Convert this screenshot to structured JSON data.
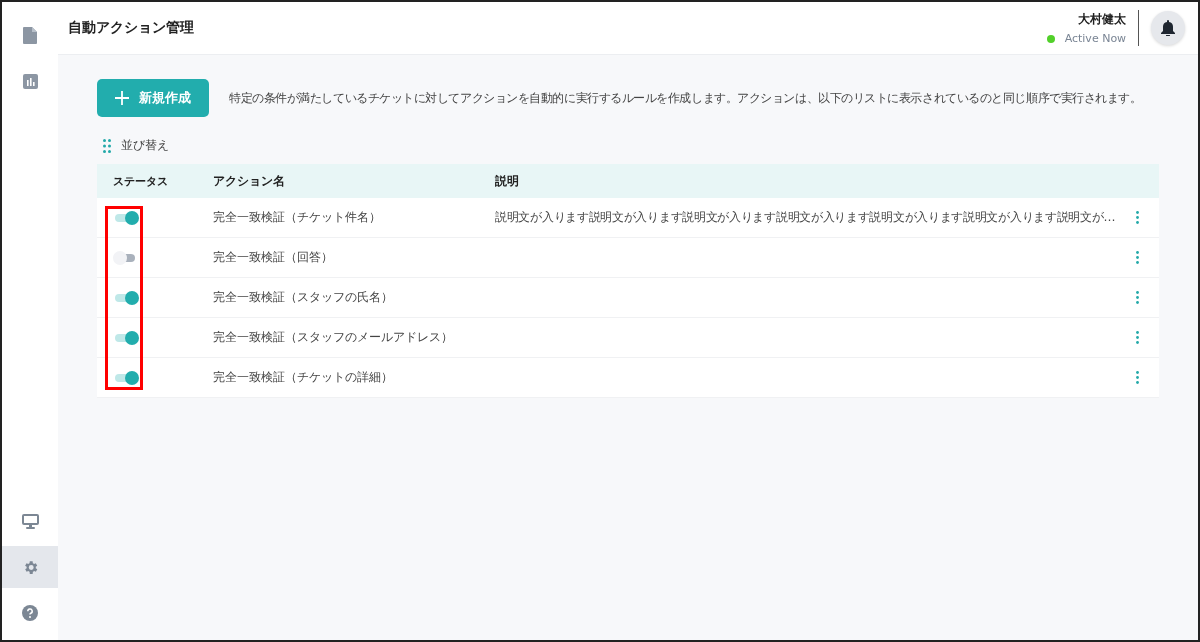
{
  "sidebar": {
    "items": [
      {
        "selected": false
      },
      {
        "selected": false
      },
      {
        "selected": false
      },
      {
        "selected": true
      },
      {
        "selected": false
      }
    ]
  },
  "header": {
    "title": "自動アクション管理",
    "user": {
      "name": "大村健太",
      "status": "Active Now",
      "online": true
    }
  },
  "toolbar": {
    "new_button": "新規作成",
    "description": "特定の条件が満たしているチケットに対してアクションを自動的に実行するルールを作成します。アクションは、以下のリストに表示されているのと同じ順序で実行されます。",
    "sort_label": "並び替え"
  },
  "table": {
    "columns": [
      "ステータス",
      "アクション名",
      "説明"
    ],
    "rows": [
      {
        "on": true,
        "name": "完全一致検証（チケット件名）",
        "description": "説明文が入ります説明文が入ります説明文が入ります説明文が入ります説明文が入ります説明文が入ります説明文が…"
      },
      {
        "on": false,
        "name": "完全一致検証（回答）"
      },
      {
        "on": true,
        "name": "完全一致検証（スタッフの氏名）"
      },
      {
        "on": true,
        "name": "完全一致検証（スタッフのメールアドレス）"
      },
      {
        "on": true,
        "name": "完全一致検証（チケットの詳細）"
      }
    ]
  }
}
